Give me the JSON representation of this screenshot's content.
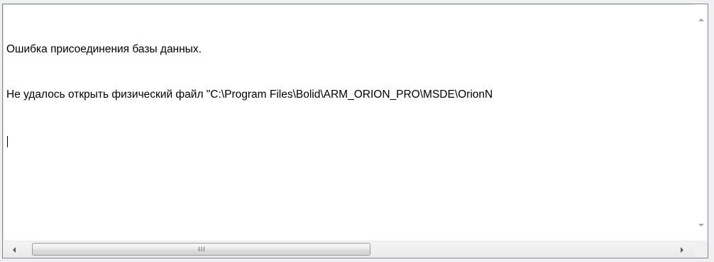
{
  "text": {
    "line1": "Ошибка присоединения базы данных.",
    "line2": "Не удалось открыть физический файл \"C:\\Program Files\\Bolid\\ARM_ORION_PRO\\MSDE\\OrionN"
  },
  "scrollbars": {
    "horizontal_grip": "III"
  }
}
